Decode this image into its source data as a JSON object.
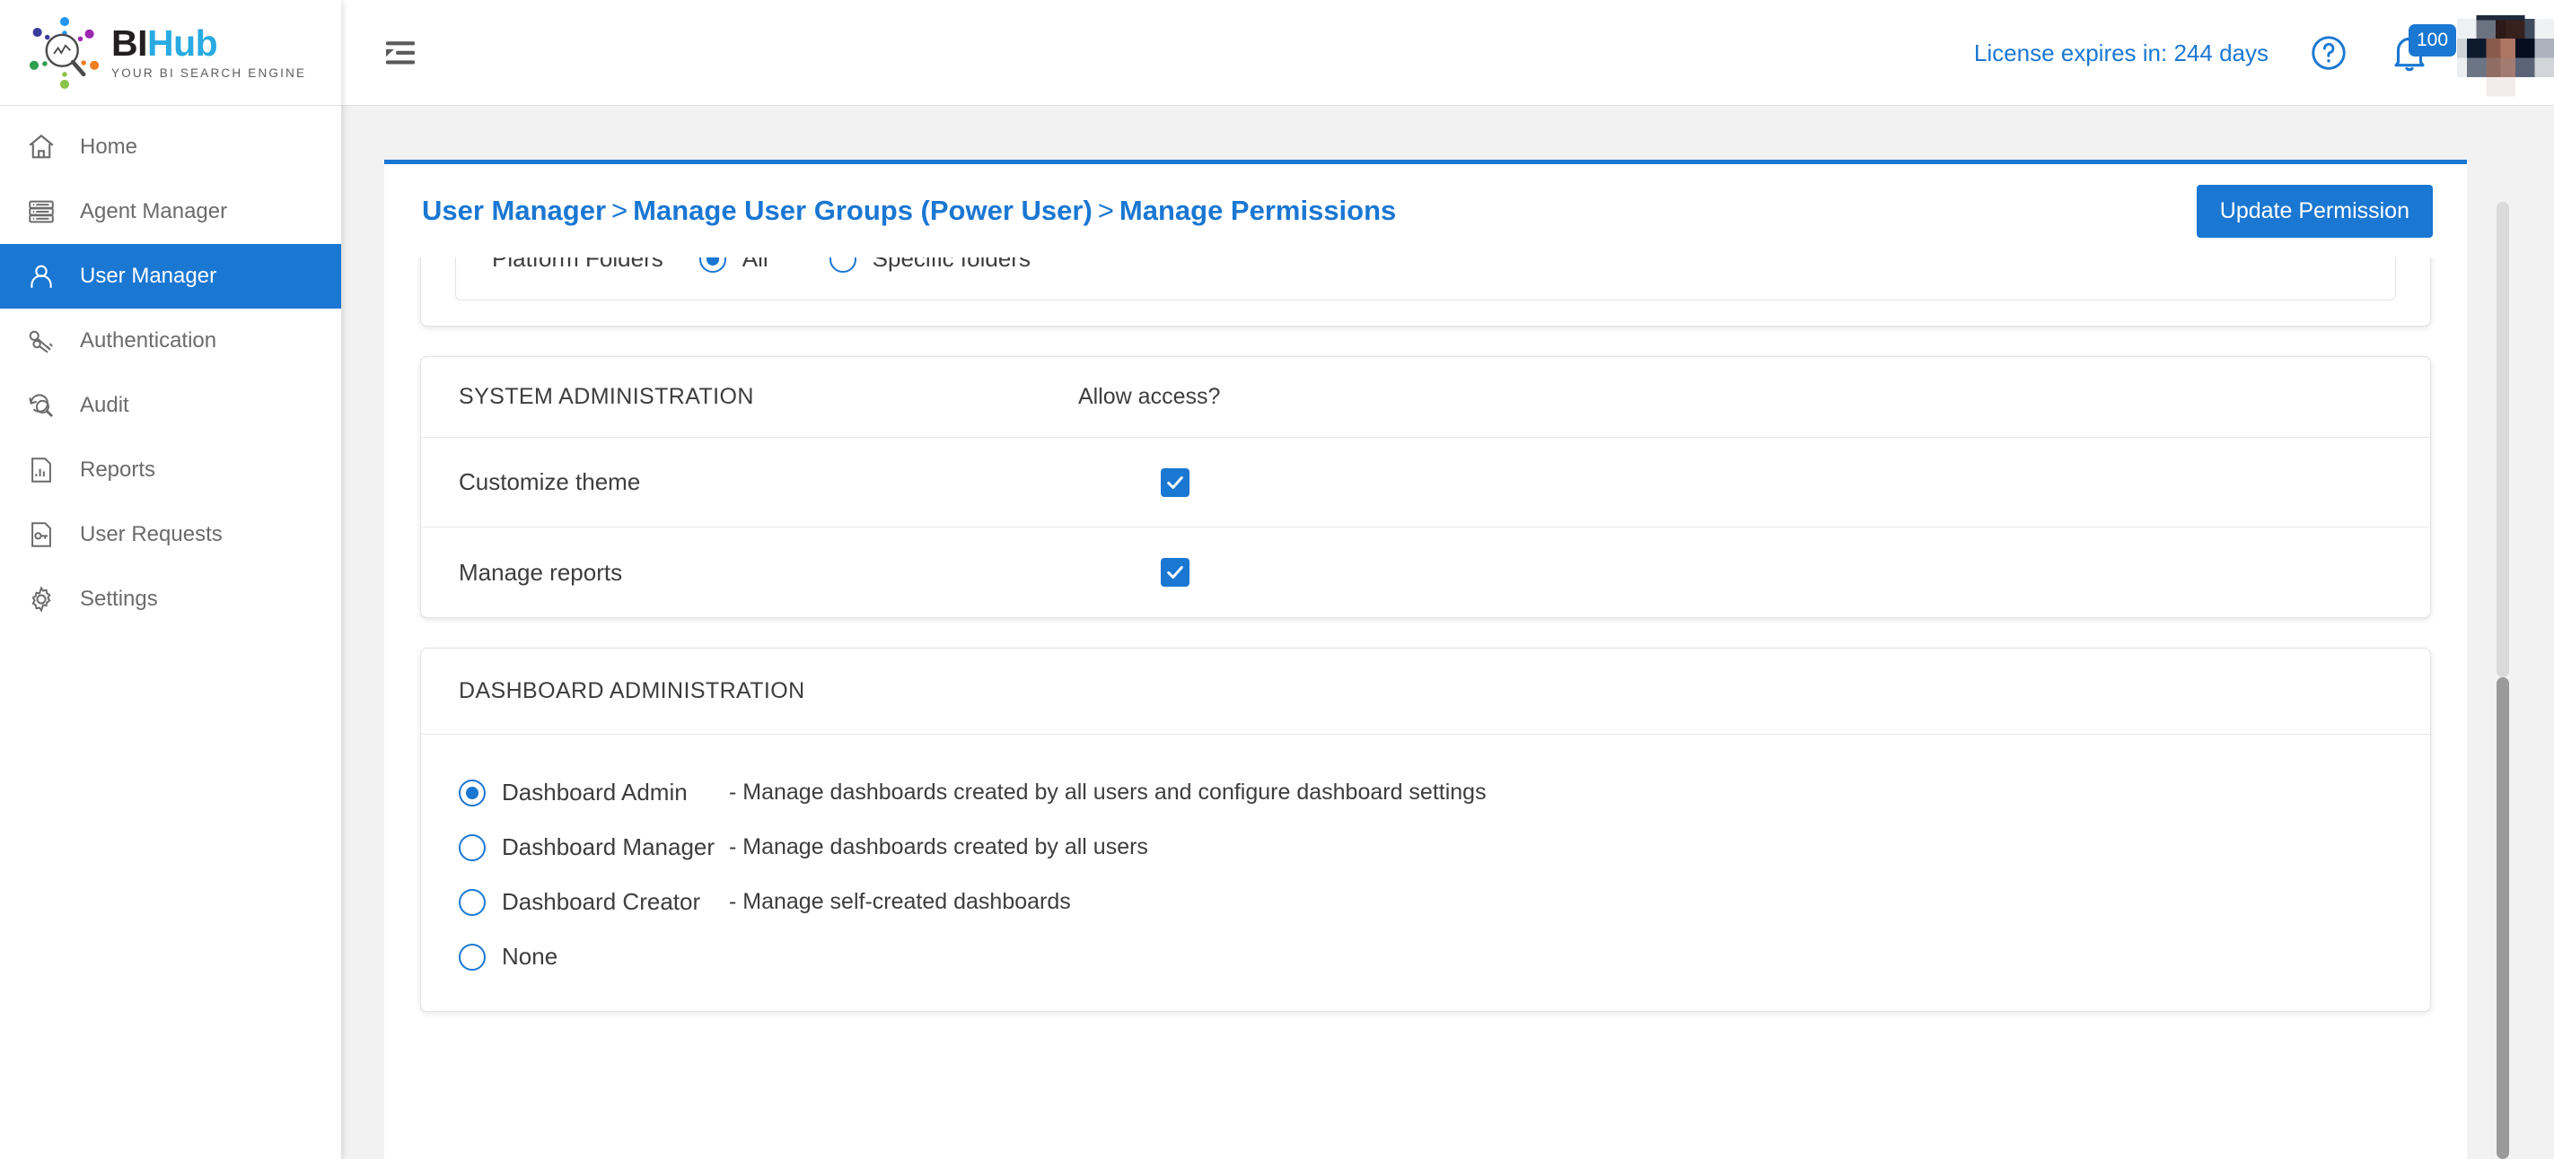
{
  "brand": {
    "name_first": "BI",
    "name_second": "Hub",
    "tagline": "YOUR BI SEARCH ENGINE",
    "accent_color": "#1a77d2",
    "logo_blue": "#29abe2"
  },
  "sidebar": {
    "items": [
      {
        "label": "Home",
        "icon": "home-icon",
        "active": false
      },
      {
        "label": "Agent Manager",
        "icon": "server-icon",
        "active": false
      },
      {
        "label": "User Manager",
        "icon": "user-icon",
        "active": true
      },
      {
        "label": "Authentication",
        "icon": "keys-icon",
        "active": false
      },
      {
        "label": "Audit",
        "icon": "audit-search-icon",
        "active": false
      },
      {
        "label": "Reports",
        "icon": "report-chart-icon",
        "active": false
      },
      {
        "label": "User Requests",
        "icon": "document-key-icon",
        "active": false
      },
      {
        "label": "Settings",
        "icon": "gear-icon",
        "active": false
      }
    ]
  },
  "topbar": {
    "menu_toggle_icon": "collapse-menu-icon",
    "license_text": "License expires in: 244 days",
    "help_icon": "question-circle-icon",
    "bell_icon": "notification-bell-icon",
    "notification_count": "100",
    "avatar": "user-avatar"
  },
  "header": {
    "breadcrumb": {
      "items": [
        "User Manager",
        "Manage User Groups  (Power User)",
        "Manage Permissions"
      ],
      "separator": ">"
    },
    "update_button": "Update Permission"
  },
  "platform_folders": {
    "label": "Platform Folders",
    "options": [
      {
        "label": "All",
        "selected": true
      },
      {
        "label": "Specific folders",
        "selected": false
      }
    ]
  },
  "system_administration": {
    "title": "SYSTEM ADMINISTRATION",
    "access_column": "Allow access?",
    "rows": [
      {
        "label": "Customize theme",
        "checked": true
      },
      {
        "label": "Manage reports",
        "checked": true
      }
    ]
  },
  "dashboard_administration": {
    "title": "DASHBOARD ADMINISTRATION",
    "options": [
      {
        "label": "Dashboard Admin",
        "description": "- Manage dashboards created by all users and configure dashboard settings",
        "selected": true
      },
      {
        "label": "Dashboard Manager",
        "description": "- Manage dashboards created by all users",
        "selected": false
      },
      {
        "label": "Dashboard Creator",
        "description": "- Manage self-created dashboards",
        "selected": false
      },
      {
        "label": "None",
        "description": "",
        "selected": false
      }
    ]
  }
}
